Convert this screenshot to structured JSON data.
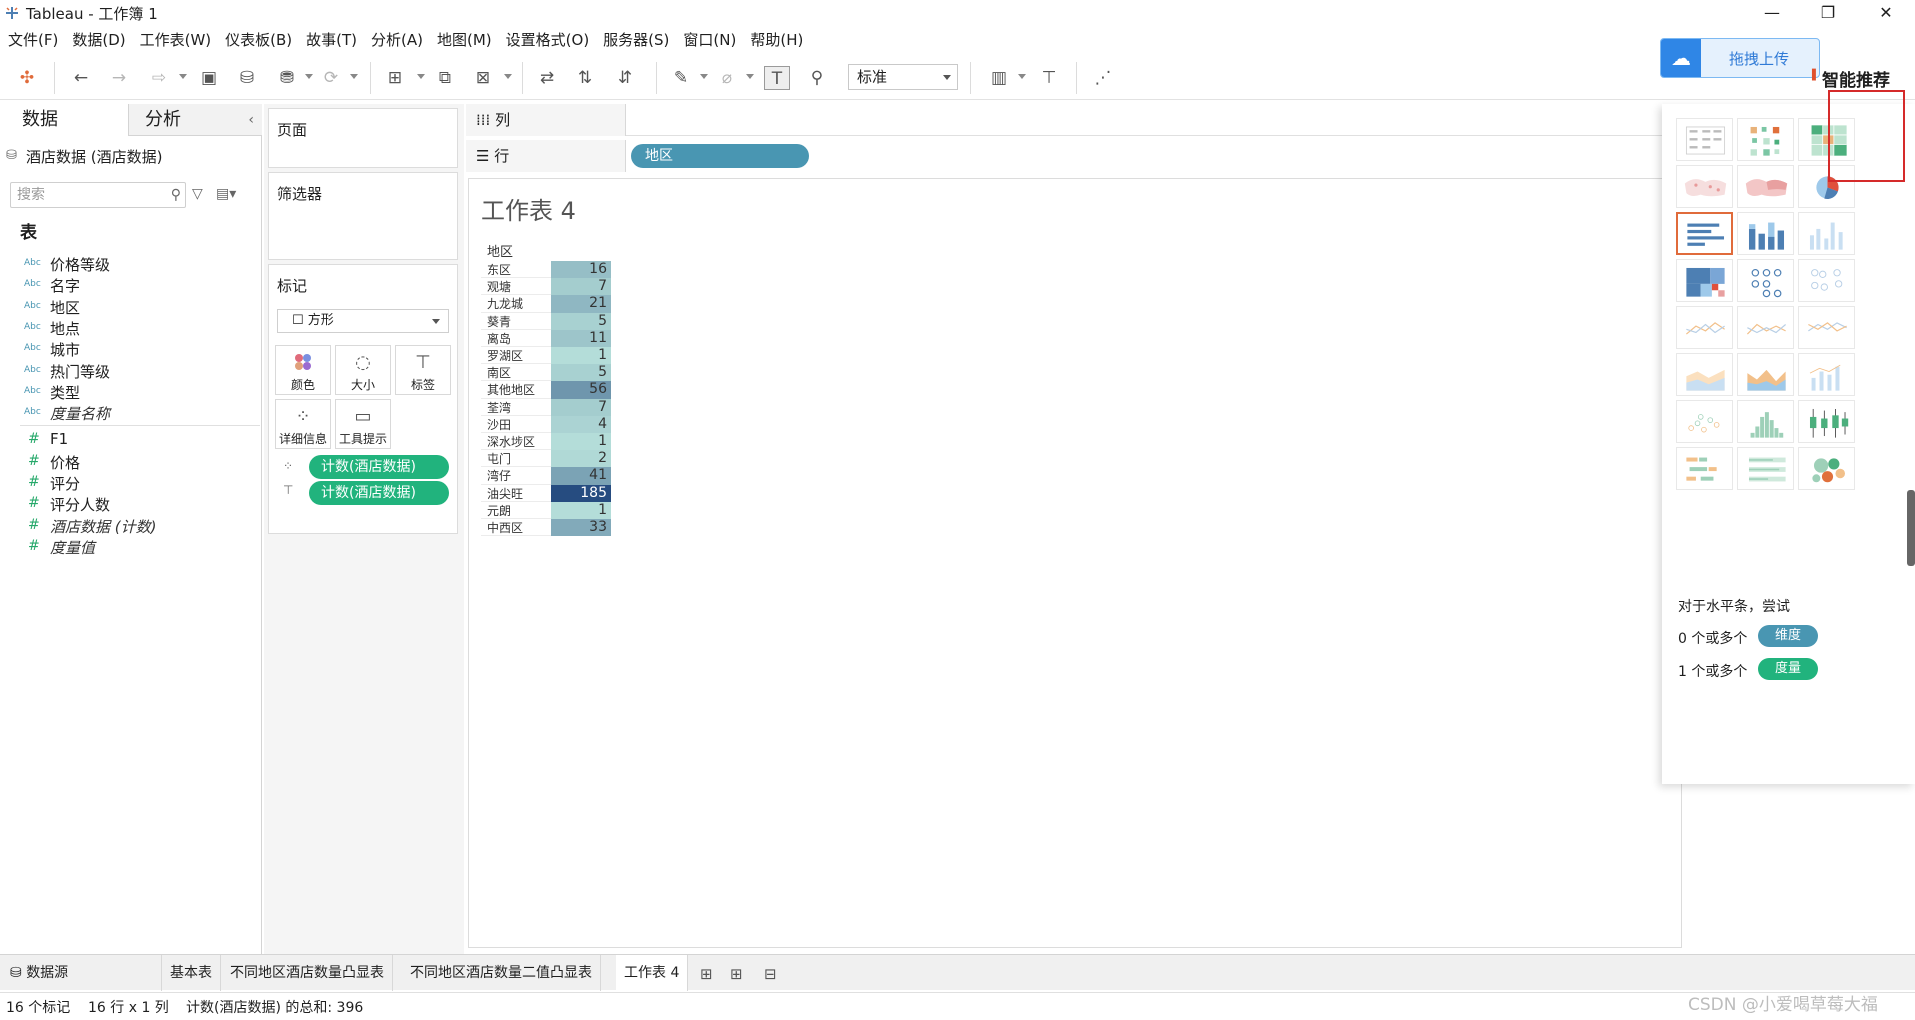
{
  "window": {
    "title": "Tableau - 工作簿 1",
    "controls": [
      "—",
      "❐",
      "✕"
    ]
  },
  "menu": [
    "文件(F)",
    "数据(D)",
    "工作表(W)",
    "仪表板(B)",
    "故事(T)",
    "分析(A)",
    "地图(M)",
    "设置格式(O)",
    "服务器(S)",
    "窗口(N)",
    "帮助(H)"
  ],
  "toolbar": {
    "fit": "标准"
  },
  "upload": {
    "label": "拖拽上传"
  },
  "left": {
    "tabs": {
      "data": "数据",
      "analysis": "分析"
    },
    "datasource": "酒店数据 (酒店数据)",
    "search_placeholder": "搜索",
    "table_heading": "表",
    "dimensions": [
      {
        "type": "Abc",
        "name": "价格等级",
        "italic": false
      },
      {
        "type": "Abc",
        "name": "名字",
        "italic": false
      },
      {
        "type": "Abc",
        "name": "地区",
        "italic": false
      },
      {
        "type": "Abc",
        "name": "地点",
        "italic": false
      },
      {
        "type": "Abc",
        "name": "城市",
        "italic": false
      },
      {
        "type": "Abc",
        "name": "热门等级",
        "italic": false
      },
      {
        "type": "Abc",
        "name": "类型",
        "italic": false
      },
      {
        "type": "Abc",
        "name": "度量名称",
        "italic": true
      }
    ],
    "measures": [
      {
        "type": "#",
        "name": "F1",
        "italic": false
      },
      {
        "type": "#",
        "name": "价格",
        "italic": false
      },
      {
        "type": "#",
        "name": "评分",
        "italic": false
      },
      {
        "type": "#",
        "name": "评分人数",
        "italic": false
      },
      {
        "type": "#",
        "name": "酒店数据 (计数)",
        "italic": true
      },
      {
        "type": "#",
        "name": "度量值",
        "italic": true
      }
    ]
  },
  "cards": {
    "pages": "页面",
    "filters": "筛选器",
    "marks": "标记",
    "mark_type": "方形",
    "mark_buttons": [
      {
        "icon": "color-icon",
        "label": "颜色"
      },
      {
        "icon": "size-icon",
        "label": "大小"
      },
      {
        "icon": "label-icon",
        "label": "标签"
      },
      {
        "icon": "detail-icon",
        "label": "详细信息"
      },
      {
        "icon": "tooltip-icon",
        "label": "工具提示"
      }
    ],
    "mark_pills": [
      "计数(酒店数据)",
      "计数(酒店数据)"
    ]
  },
  "shelves": {
    "columns": "列",
    "rows": "行",
    "row_pill": "地区"
  },
  "view": {
    "title": "工作表 4",
    "header": "地区",
    "rows": [
      {
        "label": "东区",
        "value": 16
      },
      {
        "label": "观塘",
        "value": 7
      },
      {
        "label": "九龙城",
        "value": 21
      },
      {
        "label": "葵青",
        "value": 5
      },
      {
        "label": "离岛",
        "value": 11
      },
      {
        "label": "罗湖区",
        "value": 1
      },
      {
        "label": "南区",
        "value": 5
      },
      {
        "label": "其他地区",
        "value": 56
      },
      {
        "label": "荃湾",
        "value": 7
      },
      {
        "label": "沙田",
        "value": 4
      },
      {
        "label": "深水埗区",
        "value": 1
      },
      {
        "label": "屯门",
        "value": 2
      },
      {
        "label": "湾仔",
        "value": 41
      },
      {
        "label": "油尖旺",
        "value": 185
      },
      {
        "label": "元朗",
        "value": 1
      },
      {
        "label": "中西区",
        "value": 33
      }
    ]
  },
  "showme": {
    "title": "智能推荐",
    "hint": "对于水平条，尝试",
    "dim_line": "0 个或多个",
    "dim_pill": "维度",
    "meas_line": "1 个或多个",
    "meas_pill": "度量"
  },
  "tabs": {
    "datasource": "数据源",
    "sheets": [
      "基本表",
      "不同地区酒店数量凸显表",
      "不同地区酒店数量二值凸显表",
      "工作表 4"
    ]
  },
  "status": {
    "marks": "16 个标记",
    "rowscols": "16 行 x 1 列",
    "sum": "计数(酒店数据) 的总和: 396"
  },
  "watermark": "CSDN @小爱喝草莓大福"
}
